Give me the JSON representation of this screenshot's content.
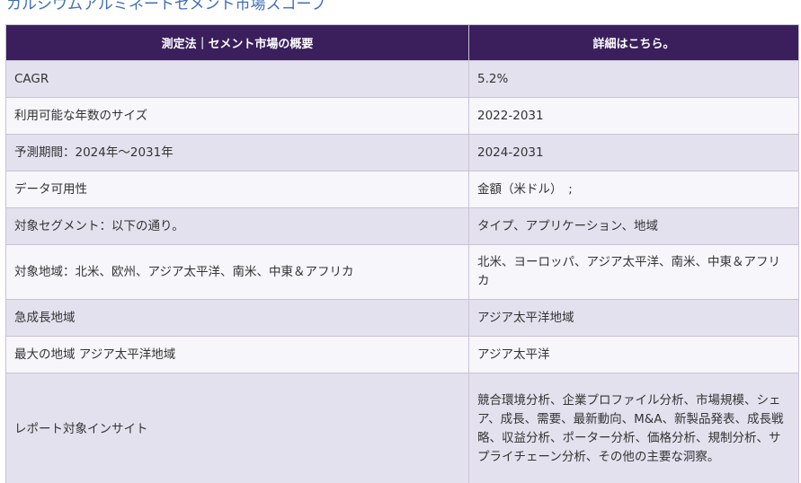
{
  "title": "カルシウムアルミネートセメント市場スコープ",
  "table": {
    "headers": [
      "測定法｜セメント市場の概要",
      "詳細はこちら。"
    ],
    "rows": [
      {
        "label": "CAGR",
        "value": "5.2%"
      },
      {
        "label": "利用可能な年数のサイズ",
        "value": "2022-2031"
      },
      {
        "label": "予測期間：2024年～2031年",
        "value": "2024-2031"
      },
      {
        "label": "データ可用性",
        "value": "金額（米ドル）　;"
      },
      {
        "label": "対象セグメント：以下の通り。",
        "value": "タイプ、アプリケーション、地域"
      },
      {
        "label": "対象地域：北米、欧州、アジア太平洋、南米、中東＆アフリカ",
        "value": "北米、ヨーロッパ、アジア太平洋、南米、中東＆アフリカ"
      },
      {
        "label": "急成長地域",
        "value": "アジア太平洋地域"
      },
      {
        "label": "最大の地域 アジア太平洋地域",
        "value": "アジア太平洋"
      },
      {
        "label": "レポート対象インサイト",
        "value": "競合環境分析、企業プロファイル分析、市場規模、シェア、成長、需要、最新動向、M&A、新製品発表、成長戦略、収益分析、ポーター分析、価格分析、規制分析、サプライチェーン分析、その他の主要な洞察。"
      }
    ]
  },
  "colors": {
    "title": "#3f6fb5",
    "header_bg": "#3a1f5c",
    "row_odd": "#e4e1ef",
    "row_even": "#f7f6fb",
    "border": "#c9c2d6"
  }
}
